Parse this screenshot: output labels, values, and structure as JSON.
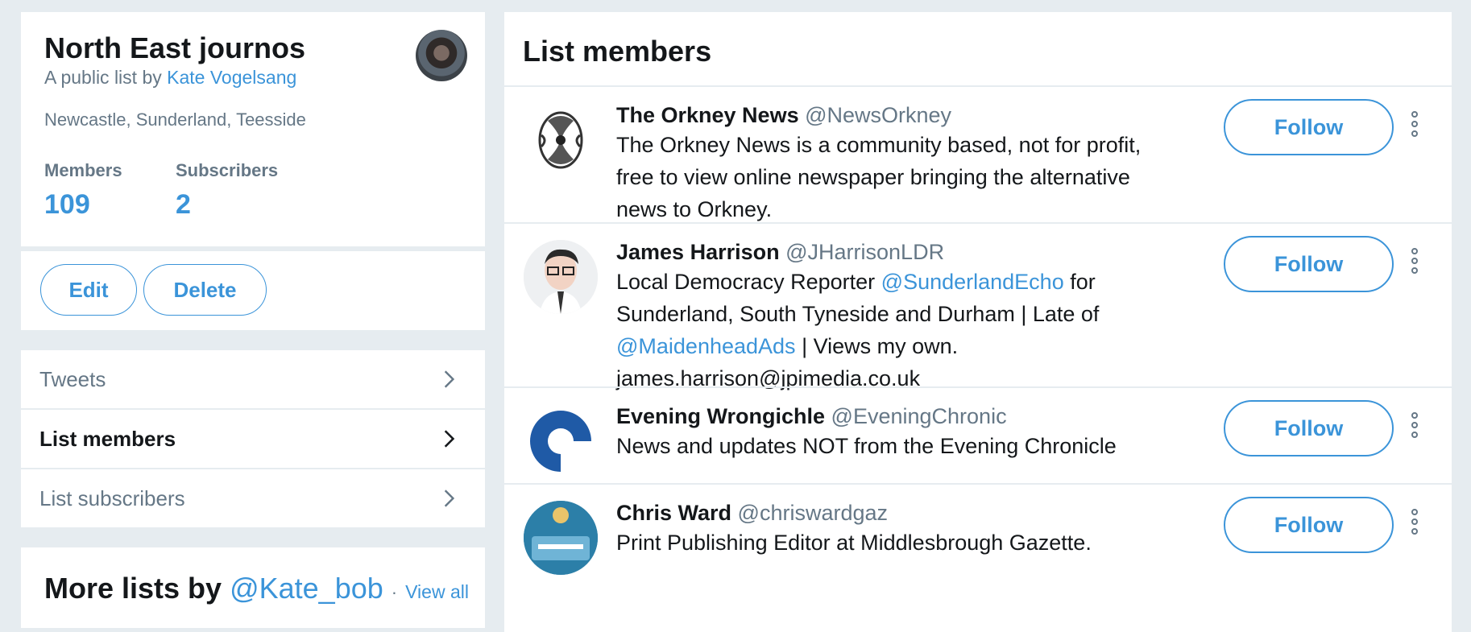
{
  "list": {
    "title": "North East journos",
    "byline_prefix": "A public list by",
    "owner": "Kate Vogelsang",
    "description": "Newcastle, Sunderland, Teesside",
    "members_label": "Members",
    "members_count": "109",
    "subscribers_label": "Subscribers",
    "subscribers_count": "2"
  },
  "actions": {
    "edit_label": "Edit",
    "delete_label": "Delete"
  },
  "nav": {
    "items": [
      {
        "label": "Tweets"
      },
      {
        "label": "List members"
      },
      {
        "label": "List subscribers"
      }
    ]
  },
  "more_lists": {
    "title": "More lists by",
    "handle": "@Kate_bob",
    "separator": "·",
    "view_all": "View all"
  },
  "members": {
    "title": "List members",
    "follow_label": "Follow",
    "items": [
      {
        "name": "The Orkney News",
        "handle": "@NewsOrkney",
        "bio": "The Orkney News is a community based, not for profit, free to view online newspaper bringing the alternative news to Orkney."
      },
      {
        "name": "James Harrison",
        "handle": "@JHarrisonLDR",
        "bio_part1": "Local Democracy Reporter",
        "bio_mention1": "@SunderlandEcho",
        "bio_part2": "for Sunderland, South Tyneside and Durham | Late of",
        "bio_mention2": "@MaidenheadAds",
        "bio_part3": "| Views my own. james.harrison@jpimedia.co.uk"
      },
      {
        "name": "Evening Wrongichle",
        "handle": "@EveningChronic",
        "bio": "News and updates NOT from the Evening Chronicle"
      },
      {
        "name": "Chris Ward",
        "handle": "@chriswardgaz",
        "bio": "Print Publishing Editor at Middlesbrough Gazette."
      }
    ]
  },
  "colors": {
    "accent": "#3b94d9",
    "muted_text": "#657786",
    "background": "#e6ecf0"
  },
  "icons": {
    "chevron": "chevron-right-icon",
    "more": "more-vertical-icon"
  }
}
